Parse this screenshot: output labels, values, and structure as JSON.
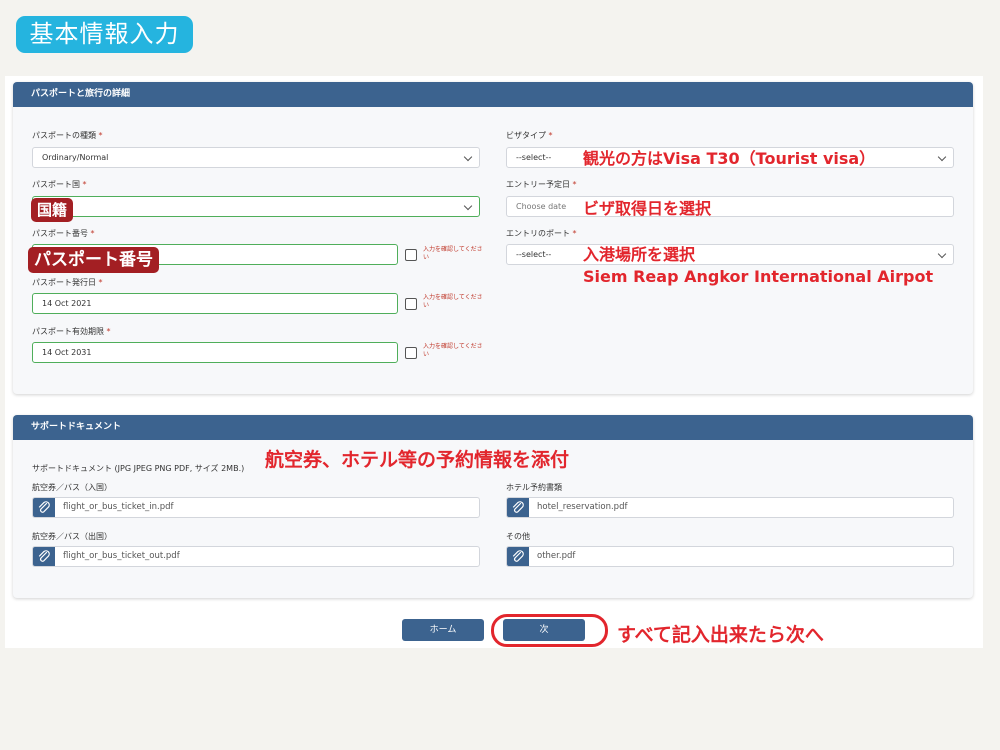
{
  "page_title": "基本情報入力",
  "passport_section": {
    "header": "パスポートと旅行の詳細",
    "passport_type": {
      "label": "パスポートの種類",
      "value": "Ordinary/Normal"
    },
    "passport_country": {
      "label": "パスポート国",
      "value": ""
    },
    "passport_number": {
      "label": "パスポート番号",
      "value": "",
      "confirm_note": "入力を確認してください"
    },
    "issue_date": {
      "label": "パスポート発行日",
      "value": "14 Oct 2021",
      "confirm_note": "入力を確認してください"
    },
    "expiry_date": {
      "label": "パスポート有効期限",
      "value": "14 Oct 2031",
      "confirm_note": "入力を確認してください"
    },
    "visa_type": {
      "label": "ビザタイプ",
      "value": "--select--"
    },
    "entry_date": {
      "label": "エントリー予定日",
      "placeholder": "Choose date"
    },
    "entry_port": {
      "label": "エントリのポート",
      "value": "--select--"
    },
    "required_mark": "*"
  },
  "documents_section": {
    "header": "サポートドキュメント",
    "note": "サポートドキュメント (JPG JPEG PNG PDF, サイズ 2MB.)",
    "flight_in": {
      "label": "航空券／バス（入国）",
      "file": "flight_or_bus_ticket_in.pdf"
    },
    "flight_out": {
      "label": "航空券／バス（出国）",
      "file": "flight_or_bus_ticket_out.pdf"
    },
    "hotel": {
      "label": "ホテル予約書類",
      "file": "hotel_reservation.pdf"
    },
    "other": {
      "label": "その他",
      "file": "other.pdf"
    }
  },
  "buttons": {
    "home": "ホーム",
    "next": "次"
  },
  "annotations": {
    "nationality": "国籍",
    "passport_number": "パスポート番号",
    "visa_hint": "観光の方はVisa T30（Tourist visa）",
    "entry_date_hint": "ビザ取得日を選択",
    "port_hint": "入港場所を選択",
    "port_example": "Siem Reap Angkor International Airpot",
    "docs_hint": "航空券、ホテル等の予約情報を添付",
    "next_hint": "すべて記入出来たら次へ"
  },
  "colors": {
    "accent": "#3c638f",
    "title_pill": "#25b4df",
    "annotation": "#e2262d"
  }
}
